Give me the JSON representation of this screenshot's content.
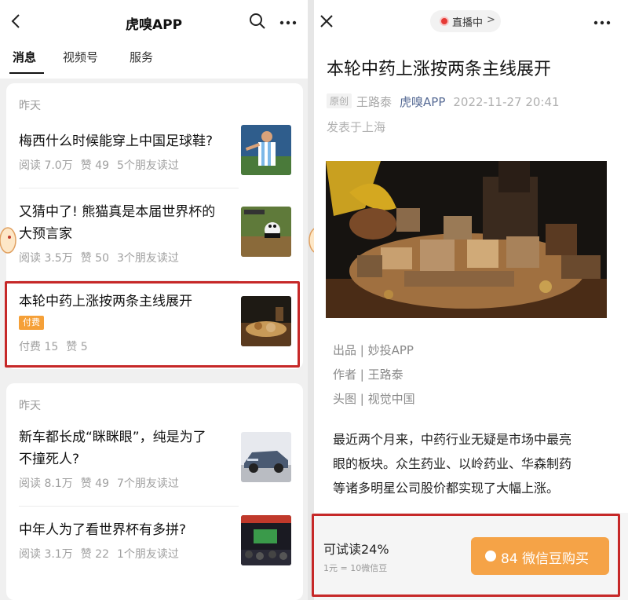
{
  "left": {
    "nav": {
      "title": "虎嗅APP",
      "back_icon": "chevron-left-icon",
      "search_icon": "search-icon",
      "more_icon": "more-dots-icon"
    },
    "tabs": [
      {
        "label": "消息",
        "active": true
      },
      {
        "label": "视频号",
        "active": false
      },
      {
        "label": "服务",
        "active": false
      }
    ],
    "groups": [
      {
        "date": "昨天",
        "items": [
          {
            "title_lines": [
              "梅西什么时候能穿上中国足球鞋?"
            ],
            "meta": [
              "阅读 7.0万",
              "赞 49",
              "5个朋友读过"
            ]
          },
          {
            "title_lines": [
              "又猜中了! 熊猫真是本届世界杯的",
              "大预言家"
            ],
            "meta": [
              "阅读 3.5万",
              "赞 50",
              "3个朋友读过"
            ]
          },
          {
            "title_lines": [
              "本轮中药上涨按两条主线展开"
            ],
            "badge": "付费",
            "meta": [
              "付费 15",
              "赞 5"
            ],
            "highlighted": true
          }
        ]
      },
      {
        "date": "昨天",
        "items": [
          {
            "title_lines": [
              "新车都长成“眯眯眼”，纯是为了",
              "不撞死人?"
            ],
            "meta": [
              "阅读 8.1万",
              "赞 49",
              "7个朋友读过"
            ]
          },
          {
            "title_lines": [
              "中年人为了看世界杯有多拼?"
            ],
            "meta": [
              "阅读 3.1万",
              "赞 22",
              "1个朋友读过"
            ]
          }
        ]
      }
    ]
  },
  "right": {
    "close_icon": "close-icon",
    "live": {
      "label": "直播中",
      "chevron": ">"
    },
    "more_icon": "more-dots-icon",
    "article": {
      "title": "本轮中药上涨按两条主线展开",
      "original_tag": "原创",
      "author": "王路泰",
      "source": "虎嗅APP",
      "time": "2022-11-27 20:41",
      "location": "发表于上海",
      "credits": [
        "出品 | 妙投APP",
        "作者 | 王路泰",
        "头图 | 视觉中国"
      ],
      "body_lines": [
        "最近两个月来，中药行业无疑是市场中最亮",
        "眼的板块。众生药业、以岭药业、华森制药",
        "等诸多明星公司股价都实现了大幅上涨。"
      ]
    },
    "paywall": {
      "try_read": "可试读24%",
      "rate": "1元 = 10微信豆",
      "buy_label": "84 微信豆购买"
    }
  },
  "colors": {
    "accent_orange": "#f5a347",
    "highlight_red": "#c62828",
    "link_blue": "#576b95",
    "live_red": "#e53935"
  }
}
